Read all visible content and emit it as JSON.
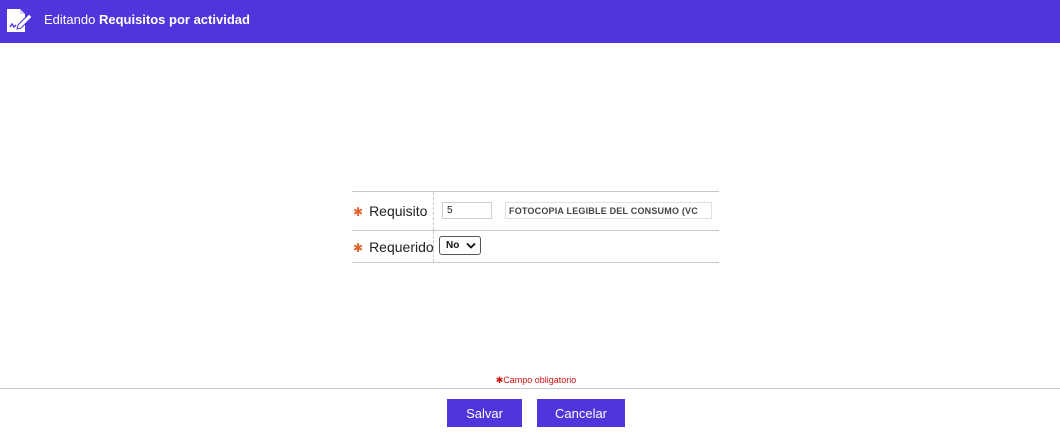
{
  "header": {
    "icon": "document-edit-icon",
    "title_prefix": "Editando",
    "title_main": "Requisitos por actividad",
    "background": "#4f35dc"
  },
  "form": {
    "requisito": {
      "label": "Requisito",
      "required_marker": "✱",
      "code_value": "5",
      "description_value": "FOTOCOPIA LEGIBLE DEL CONSUMO (VC"
    },
    "requerido": {
      "label": "Requerido",
      "required_marker": "✱",
      "selected": "No"
    }
  },
  "footer": {
    "required_note": "✱Campo obligatorio",
    "save_label": "Salvar",
    "cancel_label": "Cancelar"
  },
  "colors": {
    "accent": "#4f35dc",
    "required_star": "#e2622a",
    "required_note": "#d01010"
  }
}
